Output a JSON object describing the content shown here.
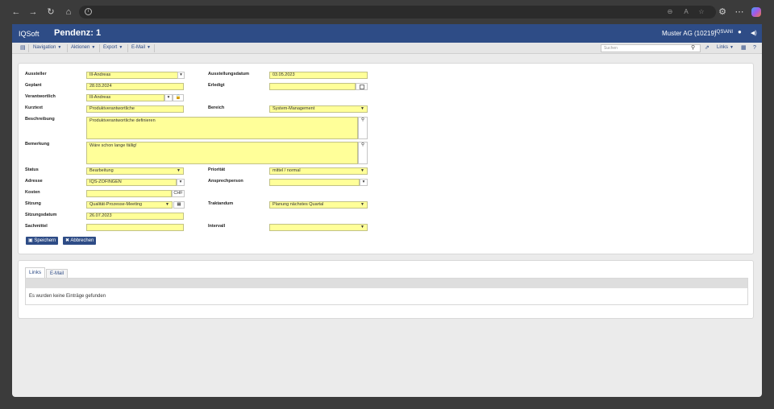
{
  "app": {
    "brand": "IQSoft",
    "title": "Pendenz: 1",
    "company": "Muster AG (10219)",
    "user": "IQS\\ANI"
  },
  "menu": {
    "items": [
      "Navigation",
      "Aktionen",
      "Export",
      "E-Mail"
    ],
    "search_placeholder": "Suchen",
    "links_label": "Links"
  },
  "form": {
    "aussteller_label": "Aussteller",
    "aussteller_value": "Ill-Andreas",
    "ausstellungsdatum_label": "Ausstellungsdatum",
    "ausstellungsdatum_value": "03.05.2023",
    "geplant_label": "Geplant",
    "geplant_value": "28.03.2024",
    "erledigt_label": "Erledigt",
    "erledigt_value": "",
    "verantwortlich_label": "Verantwortlich",
    "verantwortlich_value": "Ill-Andreas",
    "kurztext_label": "Kurztext",
    "kurztext_value": "Produktverantwortliche",
    "bereich_label": "Bereich",
    "bereich_value": "System-Management",
    "beschreibung_label": "Beschreibung",
    "beschreibung_value": "Produktverantwortliche definieren",
    "bemerkung_label": "Bemerkung",
    "bemerkung_value": "Wäre schon lange fällig!",
    "status_label": "Status",
    "status_value": "Bearbeitung",
    "prioritaet_label": "Priorität",
    "prioritaet_value": "mittel / normal",
    "adresse_label": "Adresse",
    "adresse_value": "IQS-ZOFINGEN",
    "ansprechperson_label": "Ansprechperson",
    "ansprechperson_value": "",
    "kosten_label": "Kosten",
    "kosten_value": "",
    "kosten_unit": "CHF",
    "sitzung_label": "Sitzung",
    "sitzung_value": "Qualität-Prozesse-Meeting",
    "traktandum_label": "Traktandum",
    "traktandum_value": "Planung nächstes Quartal",
    "sitzungsdatum_label": "Sitzungsdatum",
    "sitzungsdatum_value": "26.07.2023",
    "sachmittel_label": "Sachmittel",
    "sachmittel_value": "",
    "intervall_label": "Intervall",
    "intervall_value": ""
  },
  "buttons": {
    "save": "Speichern",
    "cancel": "Abbrechen"
  },
  "links_panel": {
    "tabs": [
      "Links",
      "E-Mail"
    ],
    "empty_text": "Es wurden keine Einträge gefunden"
  },
  "colors": {
    "header": "#2e4c86",
    "field_bg": "#ffff99"
  }
}
